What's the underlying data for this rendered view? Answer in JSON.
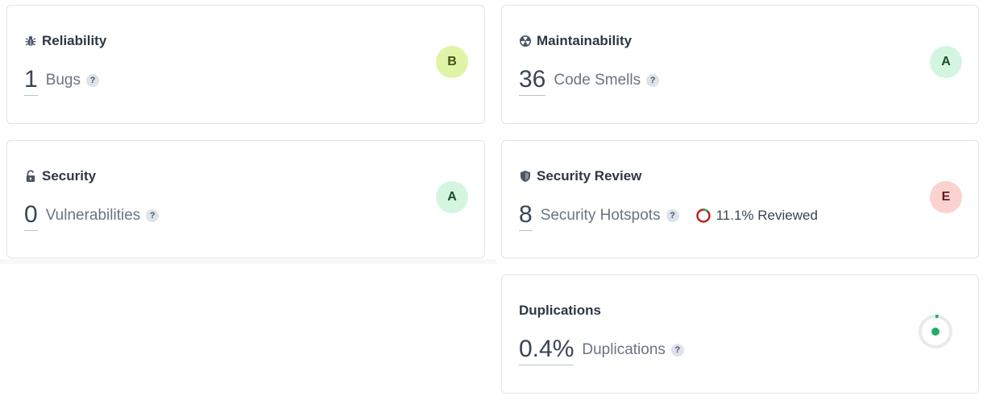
{
  "reliability": {
    "title": "Reliability",
    "value": "1",
    "label": "Bugs",
    "help": "?",
    "grade": "B",
    "grade_bg": "#dff4a6",
    "grade_fg": "#3f5210"
  },
  "maintainability": {
    "title": "Maintainability",
    "value": "36",
    "label": "Code Smells",
    "help": "?",
    "grade": "A",
    "grade_bg": "#d4f6e0",
    "grade_fg": "#1c4a2d"
  },
  "security": {
    "title": "Security",
    "value": "0",
    "label": "Vulnerabilities",
    "help": "?",
    "grade": "A",
    "grade_bg": "#d4f6e0",
    "grade_fg": "#1c4a2d"
  },
  "security_review": {
    "title": "Security Review",
    "value": "8",
    "label": "Security Hotspots",
    "help": "?",
    "reviewed_text": "11.1% Reviewed",
    "reviewed_fraction": 0.111,
    "grade": "E",
    "grade_bg": "#fbd2d0",
    "grade_fg": "#5c1f1c"
  },
  "duplications": {
    "title": "Duplications",
    "value": "0.4%",
    "label": "Duplications",
    "help": "?",
    "fraction": 0.004
  },
  "colors": {
    "ring_track": "#e6eaf0",
    "ring_good": "#1fae66",
    "ring_bad": "#b3261e"
  },
  "icons": {
    "reliability": "bug-icon",
    "maintainability": "radiation-icon",
    "security": "unlock-icon",
    "security_review": "shield-icon"
  }
}
